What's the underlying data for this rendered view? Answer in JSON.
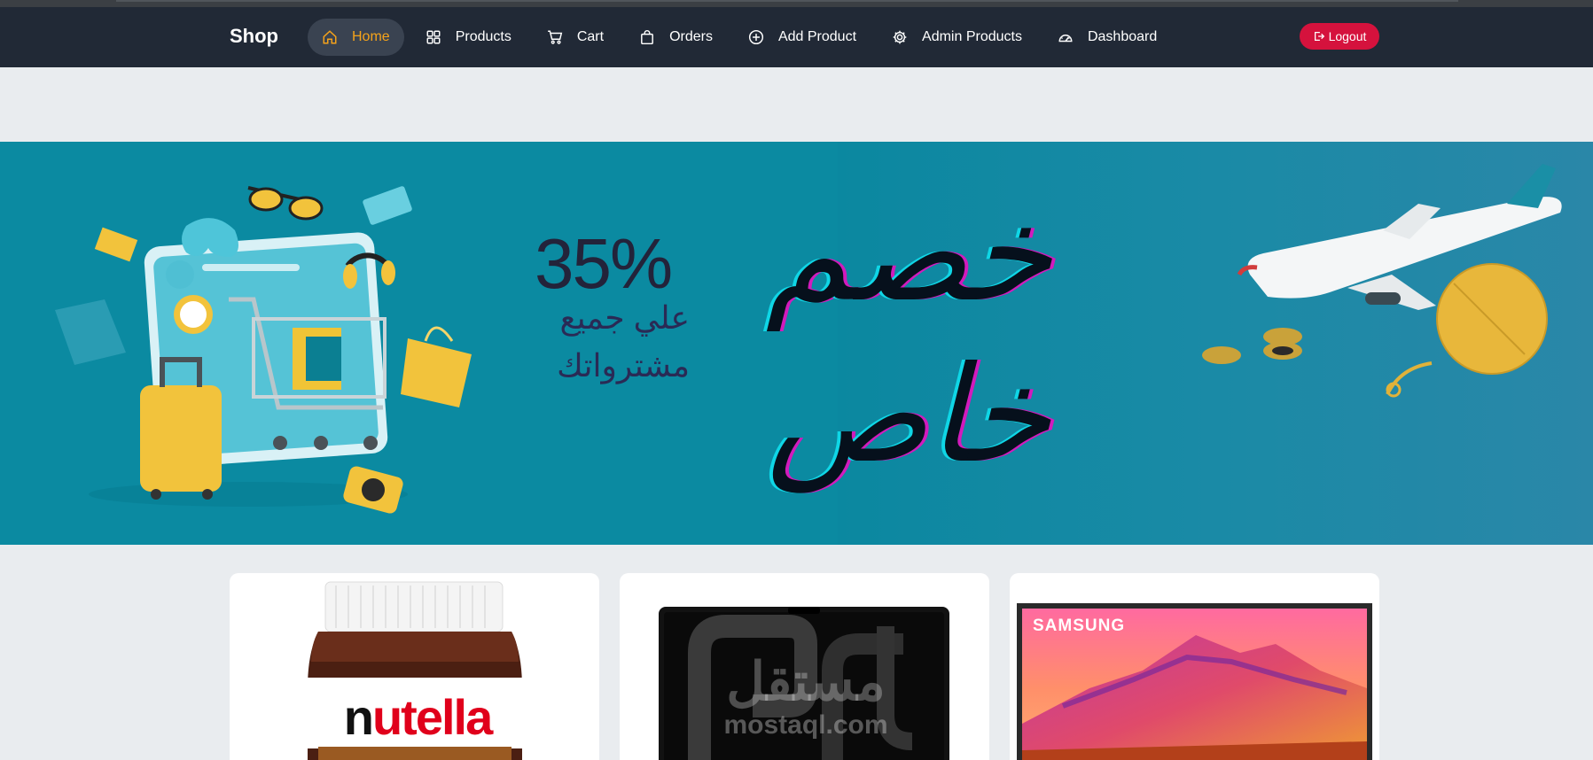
{
  "navbar": {
    "brand": "Shop",
    "items": [
      {
        "label": "Home",
        "icon": "home-icon",
        "active": true
      },
      {
        "label": "Products",
        "icon": "grid-icon",
        "active": false
      },
      {
        "label": "Cart",
        "icon": "cart-icon",
        "active": false
      },
      {
        "label": "Orders",
        "icon": "bag-icon",
        "active": false
      },
      {
        "label": "Add Product",
        "icon": "plus-circle-icon",
        "active": false
      },
      {
        "label": "Admin Products",
        "icon": "gear-icon",
        "active": false
      },
      {
        "label": "Dashboard",
        "icon": "speedometer-icon",
        "active": false
      }
    ],
    "logout_label": "Logout",
    "accent_color": "#f5a31a",
    "logout_color": "#d5123d"
  },
  "banner": {
    "discount": "35%",
    "line_sub1": "علي جميع",
    "line_sub2": "مشترواتك",
    "headline1": "خصم",
    "headline2": "خاص",
    "background_color": "#0b8aa1"
  },
  "products": [
    {
      "brand_text_part1": "n",
      "brand_text_part2": "utella",
      "image": "nutella-jar"
    },
    {
      "watermark_ar": "مستقل",
      "watermark_en": "mostaql.com",
      "image": "laptop-screen"
    },
    {
      "brand_text": "SAMSUNG",
      "image": "samsung-tv"
    }
  ]
}
